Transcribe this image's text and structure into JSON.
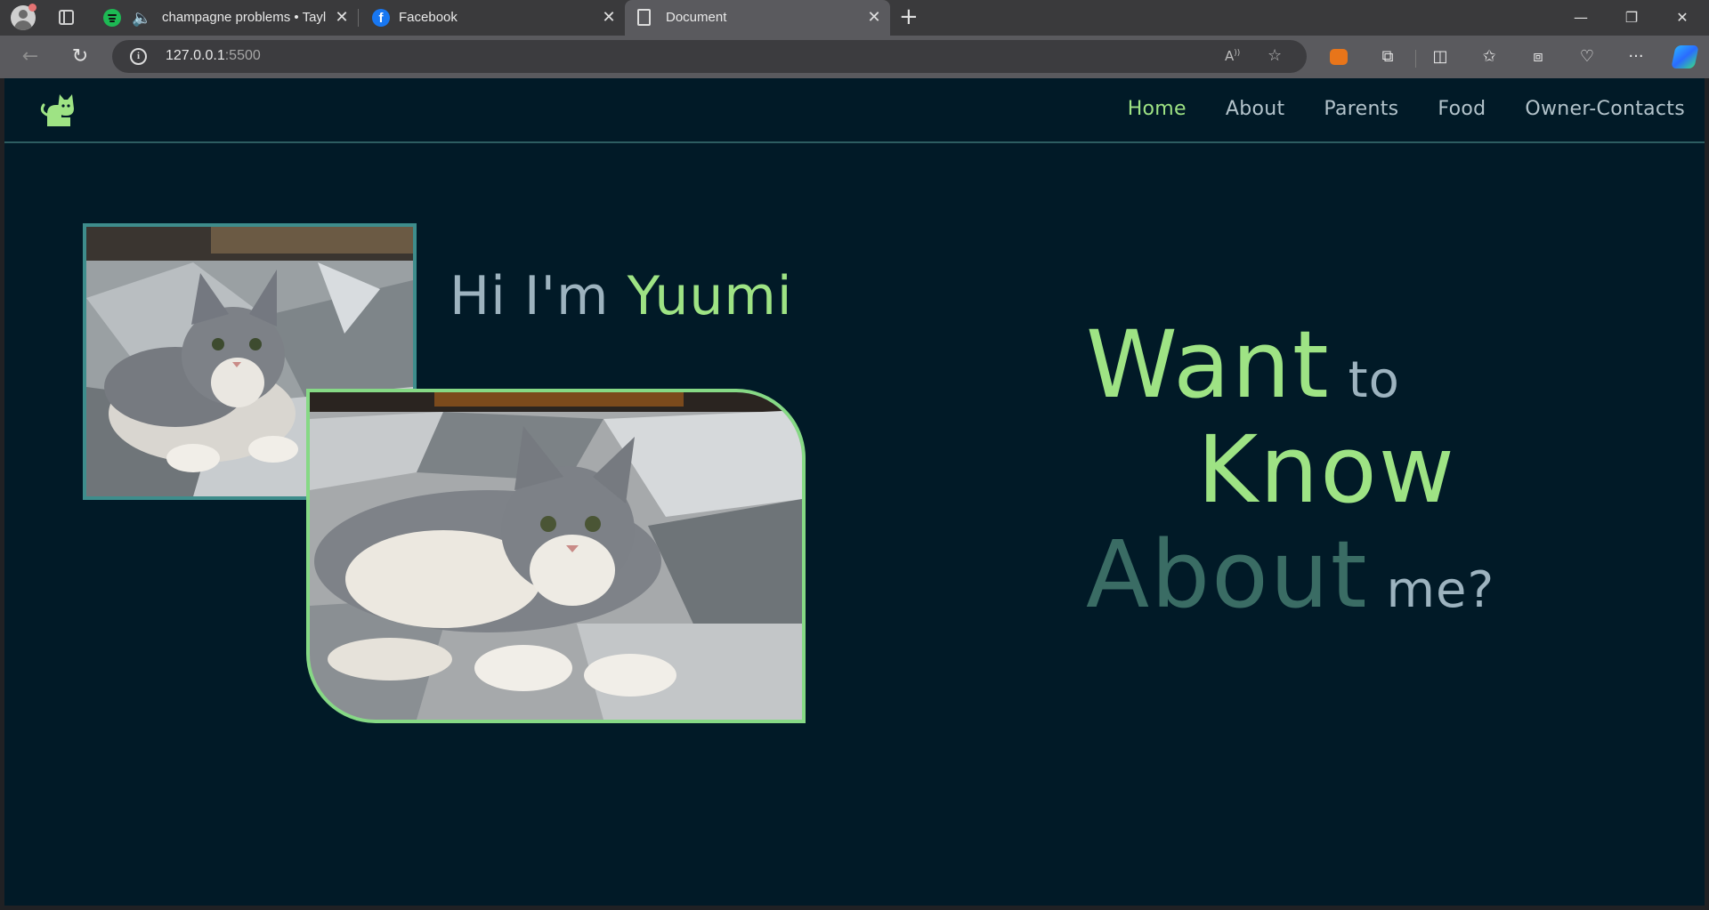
{
  "browser": {
    "tabs": [
      {
        "title": "champagne problems • Tayl",
        "icon": "spotify-icon",
        "audio": "speaker-icon"
      },
      {
        "title": "Facebook",
        "icon": "facebook-icon"
      },
      {
        "title": "Document",
        "icon": "document-icon",
        "active": true
      }
    ],
    "address": {
      "host": "127.0.0.1",
      "port": ":5500"
    },
    "colors": {
      "tabbar": "#3a3a3c",
      "toolbar": "#5a5a5e",
      "omnibox": "#3c3c3f"
    }
  },
  "page": {
    "logo_icon": "cat-icon",
    "nav": [
      "Home",
      "About",
      "Parents",
      "Food",
      "Owner-Contacts"
    ],
    "active_nav": "Home",
    "greeting": {
      "prefix": "Hi I'm",
      "name": "Yuumi"
    },
    "tagline": {
      "w1": "Want",
      "w2": "to",
      "w3": "Know",
      "w4": "About",
      "w5": "me?"
    },
    "colors": {
      "background": "#011a27",
      "accent_green": "#9ee384",
      "muted": "#9db3bf",
      "teal": "#3e8d8c",
      "dark_teal": "#3a6c64"
    }
  }
}
